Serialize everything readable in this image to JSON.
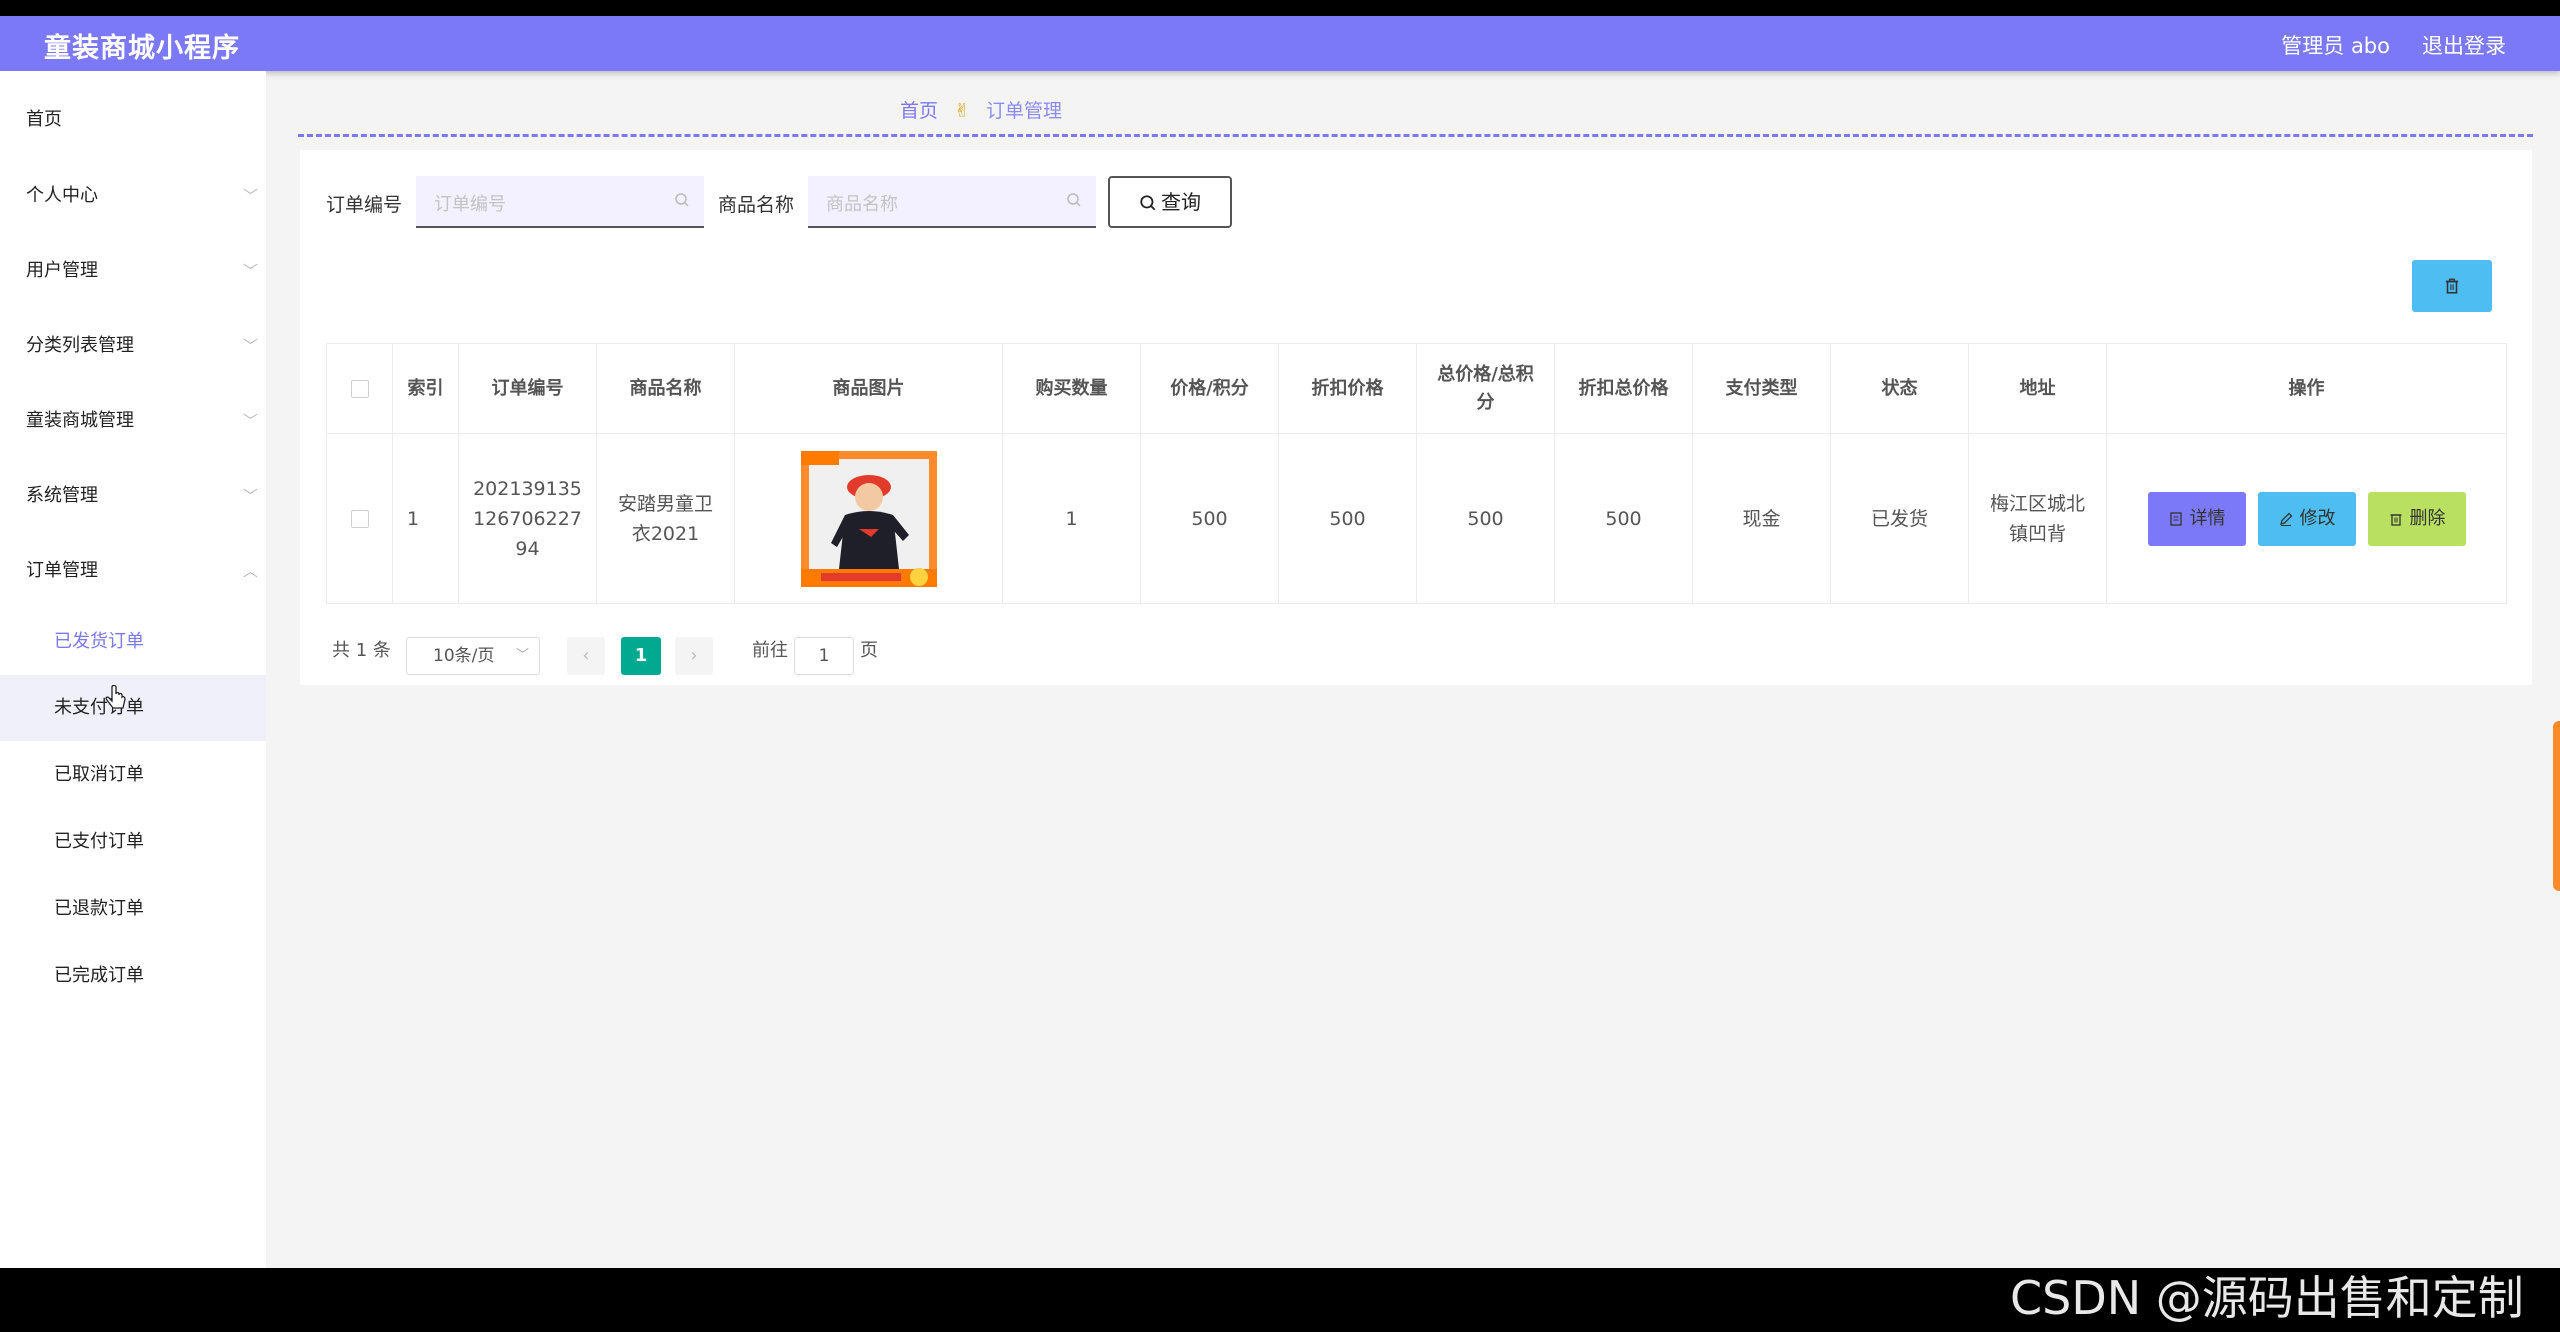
{
  "header": {
    "brand": "童装商城小程序",
    "admin_label": "管理员 abo",
    "logout_label": "退出登录"
  },
  "sidebar": {
    "items": [
      {
        "label": "首页"
      },
      {
        "label": "个人中心"
      },
      {
        "label": "用户管理"
      },
      {
        "label": "分类列表管理"
      },
      {
        "label": "童装商城管理"
      },
      {
        "label": "系统管理"
      },
      {
        "label": "订单管理"
      }
    ],
    "sub_items": [
      {
        "label": "已发货订单"
      },
      {
        "label": "未支付订单"
      },
      {
        "label": "已取消订单"
      },
      {
        "label": "已支付订单"
      },
      {
        "label": "已退款订单"
      },
      {
        "label": "已完成订单"
      }
    ]
  },
  "breadcrumb": {
    "home": "首页",
    "current": "订单管理"
  },
  "search": {
    "order_no_label": "订单编号",
    "order_no_placeholder": "订单编号",
    "goods_name_label": "商品名称",
    "goods_name_placeholder": "商品名称",
    "query_label": "查询"
  },
  "table": {
    "columns": [
      "索引",
      "订单编号",
      "商品名称",
      "商品图片",
      "购买数量",
      "价格/积分",
      "折扣价格",
      "总价格/总积分",
      "折扣总价格",
      "支付类型",
      "状态",
      "地址",
      "操作"
    ],
    "rows": [
      {
        "index": "1",
        "order_no": "20213913512670622794",
        "goods_name": "安踏男童卫衣2021",
        "quantity": "1",
        "price": "500",
        "discount_price": "500",
        "total_price": "500",
        "discount_total": "500",
        "pay_type": "现金",
        "status": "已发货",
        "address": "梅江区城北镇凹背"
      }
    ],
    "actions": {
      "detail": "详情",
      "edit": "修改",
      "delete": "删除"
    }
  },
  "pagination": {
    "total": "共 1 条",
    "page_size": "10条/页",
    "current_page": "1",
    "goto_label": "前往",
    "goto_value": "1",
    "page_suffix": "页"
  },
  "watermark": "CSDN @源码出售和定制",
  "colors": {
    "accent": "#7b79f7",
    "info": "#4dbdf2",
    "success": "#b9e060",
    "pager_active": "#00a98f"
  }
}
